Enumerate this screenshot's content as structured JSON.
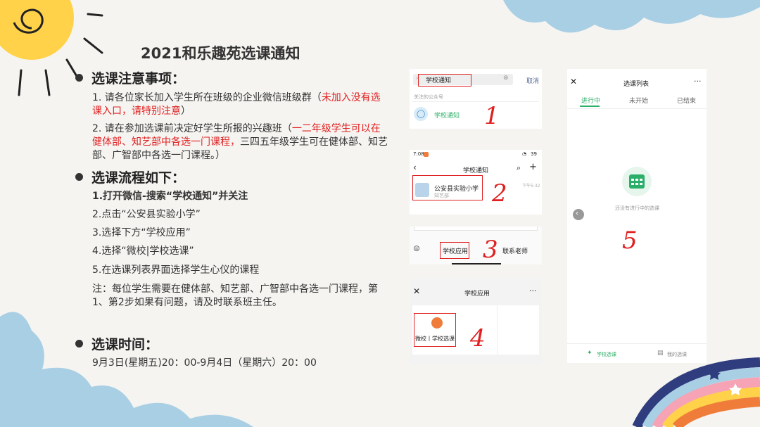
{
  "title": "2021和乐趣苑选课通知",
  "sections": {
    "notes": {
      "heading": "选课注意事项：",
      "item1_prefix": "1. 请各位家长加入学生所在班级的企业微信班级群（",
      "item1_red": "未加入没有选课入口，请特别注意",
      "item1_suffix": "）",
      "item2_prefix": "2. 请在参加选课前决定好学生所报的兴趣班（",
      "item2_red": "一二年级学生可以在健体部、知艺部中各选一门课程，",
      "item2_suffix": "三四五年级学生可在健体部、知艺部、广智部中各选一门课程。）"
    },
    "process": {
      "heading": "选课流程如下：",
      "steps": [
        "1.打开微信-搜索“学校通知”并关注",
        "2.点击“公安县实验小学”",
        "3.选择下方“学校应用”",
        "4.选择“微校|学校选课”",
        "5.在选课列表界面选择学生心仪的课程"
      ],
      "note": "注：每位学生需要在健体部、知艺部、广智部中各选一门课程，第1、第2步如果有问题，请及时联系班主任。"
    },
    "time": {
      "heading": "选课时间：",
      "value": "9月3日(星期五)20：00-9月4日（星期六）20：00"
    }
  },
  "shots": {
    "s1": {
      "search_text": "学校通知",
      "cancel": "取消",
      "section_label": "关注的公众号",
      "account": "学校通知",
      "num": "1"
    },
    "s2": {
      "time": "7:08",
      "battery": "39",
      "header": "学校通知",
      "school": "公安县实验小学",
      "sub": "知艺部",
      "msgtime": "下午5:32",
      "num": "2"
    },
    "s3": {
      "tab1": "学校应用",
      "tab2": "联系老师",
      "num": "3"
    },
    "s4": {
      "header": "学校应用",
      "app": "微校丨学校选课",
      "num": "4"
    },
    "s5": {
      "header": "选课列表",
      "tabs": [
        "进行中",
        "未开始",
        "已结束"
      ],
      "empty": "还没有进行中的选课",
      "bottom1": "学校选课",
      "bottom2": "我的选课",
      "num": "5"
    }
  },
  "colors": {
    "accent_green": "#2bae67",
    "red": "#e02020",
    "sun": "#ffd24a",
    "cloud": "#a9cfe4"
  }
}
